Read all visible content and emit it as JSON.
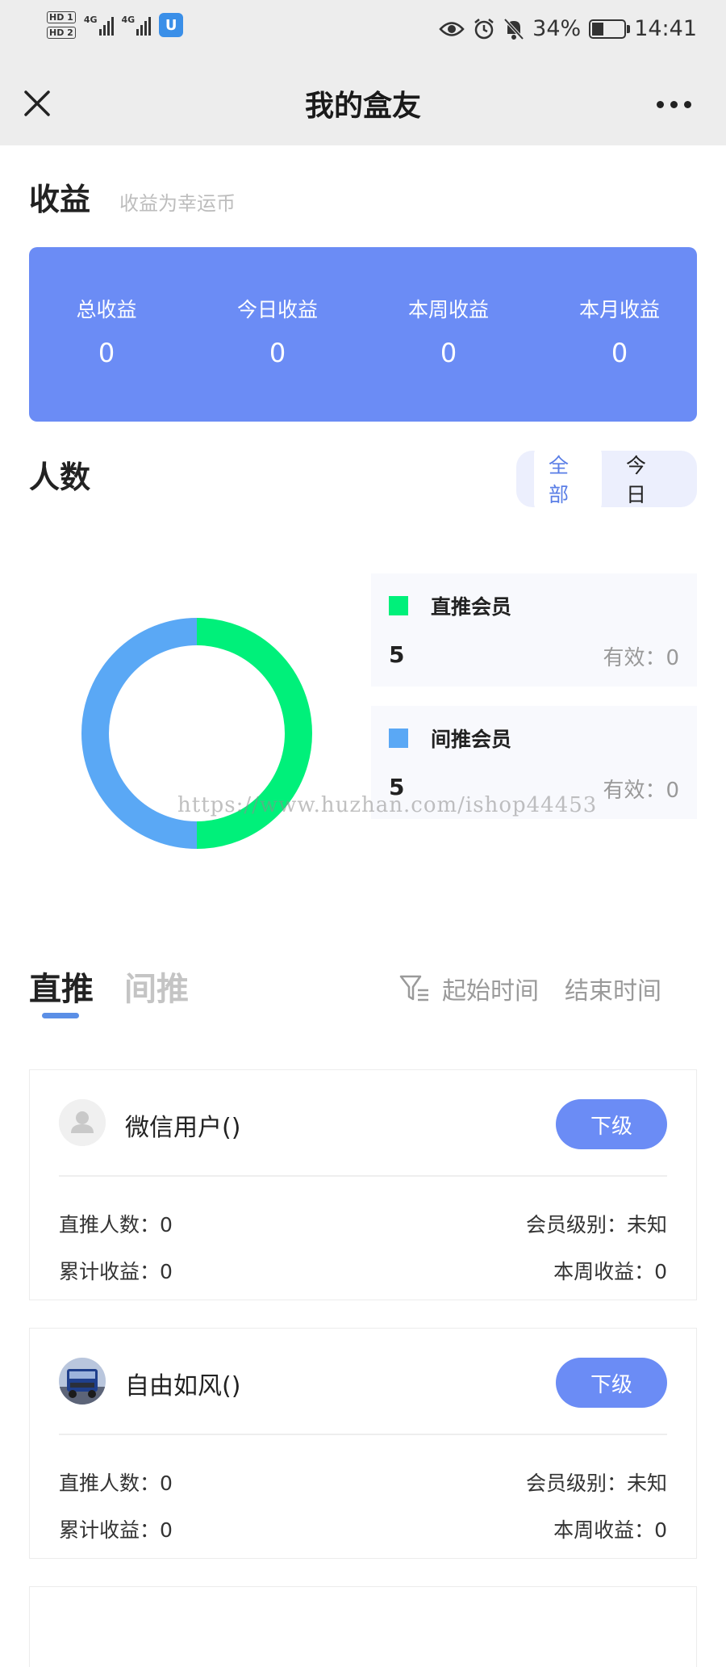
{
  "status_bar": {
    "network_1": "HD 1",
    "network_2": "HD 2",
    "signal_label_1": "4G",
    "signal_label_2": "4G",
    "battery": "34%",
    "time": "14:41"
  },
  "nav": {
    "title": "我的盒友"
  },
  "earnings": {
    "title": "收益",
    "subtitle": "收益为幸运币",
    "items": [
      {
        "label": "总收益",
        "value": "0"
      },
      {
        "label": "今日收益",
        "value": "0"
      },
      {
        "label": "本周收益",
        "value": "0"
      },
      {
        "label": "本月收益",
        "value": "0"
      }
    ]
  },
  "people": {
    "title": "人数",
    "toggle": [
      "全部",
      "今日"
    ],
    "toggle_active": "全部",
    "legend": [
      {
        "name": "直推会员",
        "count": "5",
        "valid_label": "有效：",
        "valid": "0",
        "color": "#00f07a"
      },
      {
        "name": "间推会员",
        "count": "5",
        "valid_label": "有效：",
        "valid": "0",
        "color": "#5aa8f5"
      }
    ]
  },
  "chart_data": {
    "type": "pie",
    "categories": [
      "直推会员",
      "间推会员"
    ],
    "values": [
      5,
      5
    ],
    "colors": [
      "#00f07a",
      "#5aa8f5"
    ],
    "title": "",
    "donut": true
  },
  "watermark": "https://www.huzhan.com/ishop44453",
  "tabs": {
    "items": [
      "直推",
      "间推"
    ],
    "active": "直推",
    "start_time": "起始时间",
    "end_time": "结束时间"
  },
  "members": [
    {
      "name": "微信用户()",
      "button": "下级",
      "direct_label": "直推人数：",
      "direct": "0",
      "level_label": "会员级别：",
      "level": "未知",
      "total_label": "累计收益：",
      "total": "0",
      "week_label": "本周收益：",
      "week": "0"
    },
    {
      "name": "自由如风()",
      "button": "下级",
      "direct_label": "直推人数：",
      "direct": "0",
      "level_label": "会员级别：",
      "level": "未知",
      "total_label": "累计收益：",
      "total": "0",
      "week_label": "本周收益：",
      "week": "0"
    }
  ]
}
